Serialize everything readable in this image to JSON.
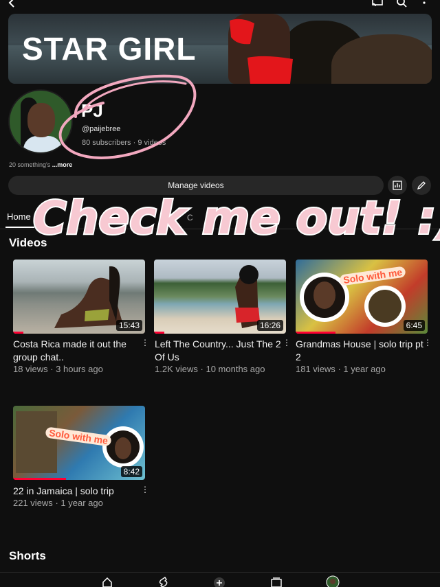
{
  "banner": {
    "title": "STAR GIRL"
  },
  "channel": {
    "name": "PJ",
    "handle": "@paijebree",
    "subscribers": "80 subscribers",
    "separator": "·",
    "videos_count": "9 videos",
    "bio": "20 something's ",
    "more_label": "...more"
  },
  "actions": {
    "manage_videos": "Manage videos"
  },
  "tabs": {
    "home": "Home",
    "partial": "C"
  },
  "overlay_text": "Check me out! :)",
  "sections": {
    "videos": "Videos",
    "shorts": "Shorts"
  },
  "videos": [
    {
      "title": "Costa Rica made it out the group chat..",
      "views": "18 views",
      "age": "3 hours ago",
      "duration": "15:43",
      "progress": 0.08
    },
    {
      "title": "Left The Country... Just The 2 Of Us",
      "views": "1.2K views",
      "age": "10 months ago",
      "duration": "16:26",
      "progress": 0.08
    },
    {
      "title": "Grandmas House | solo trip pt 2",
      "views": "181 views",
      "age": "1 year ago",
      "duration": "6:45",
      "progress": 0.3
    },
    {
      "title": "22 in Jamaica | solo trip",
      "views": "221 views",
      "age": "1 year ago",
      "duration": "8:42",
      "progress": 0.4
    }
  ],
  "thumb_text": {
    "solo_with_me": "Solo with me"
  },
  "meta_dot": "·",
  "colors": {
    "accent_red": "#ff0033",
    "overlay_fill": "#f7c9d2",
    "overlay_outline": "#ffffff",
    "background": "#0f0f0f"
  },
  "icons": [
    "back-icon",
    "cast-icon",
    "search-icon",
    "more-vert-icon",
    "analytics-icon",
    "edit-icon",
    "home-icon",
    "shorts-icon",
    "create-icon",
    "subscriptions-icon",
    "avatar-icon"
  ]
}
